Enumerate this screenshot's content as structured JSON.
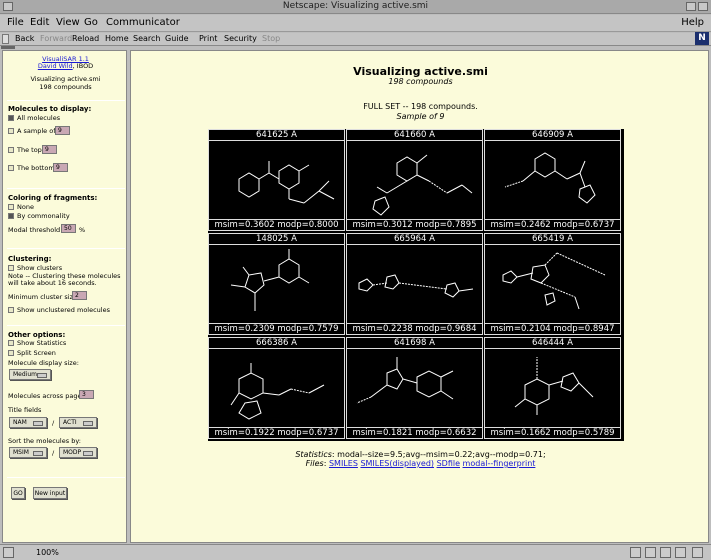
{
  "window": {
    "title": "Netscape: Visualizing active.smi"
  },
  "menu": {
    "file": "File",
    "edit": "Edit",
    "view": "View",
    "go": "Go",
    "communicator": "Communicator",
    "help": "Help"
  },
  "toolbar": {
    "back": "Back",
    "forward": "Forward",
    "reload": "Reload",
    "home": "Home",
    "search": "Search",
    "guide": "Guide",
    "print": "Print",
    "security": "Security",
    "stop": "Stop",
    "logo": "N"
  },
  "sidebar": {
    "app_name": "VisualiSAR 1.1",
    "author": "David Wild",
    "org": ", IBOD",
    "file_title": "Visualizing active.smi",
    "compounds": "198 compounds",
    "display_heading": "Molecules to display:",
    "all_molecules": "All molecules",
    "sample_of": "A sample of",
    "sample_value": "9",
    "the_top": "The top",
    "top_value": "9",
    "the_bottom": "The bottom",
    "bottom_value": "9",
    "coloring_heading": "Coloring of fragments:",
    "none": "None",
    "by_commonality": "By commonality",
    "modal_threshold": "Modal threshold",
    "threshold_value": "50",
    "percent": "%",
    "clustering_heading": "Clustering:",
    "show_clusters": "Show clusters",
    "note1": "Note -- Clustering these molecules",
    "note2": "will take about 16 seconds.",
    "min_cluster_size": "Minimum cluster size",
    "min_cluster_value": "2",
    "show_unclustered": "Show unclustered molecules",
    "other_heading": "Other options:",
    "show_statistics": "Show Statistics",
    "split_screen": "Split Screen",
    "display_size": "Molecule display size:",
    "display_size_value": "Medium",
    "across_page": "Molecules across page",
    "across_value": "3",
    "title_fields": "Title fields",
    "title_field_1": "NAM",
    "slash": "/",
    "title_field_2": "ACTI",
    "sort_by": "Sort the molecules by:",
    "sort_field_1": "MSIM",
    "sort_field_2": "MODP",
    "go": "GO",
    "new_input": "New input"
  },
  "main": {
    "title": "Visualizing active.smi",
    "subtitle": "198 compounds",
    "full_set": "FULL SET -- 198 compounds.",
    "sample": "Sample of 9",
    "stats_label": "Statistics",
    "stats_text": ": modal--size=9.5;avg--msim=0.22;avg--modp=0.71;",
    "files_label": "Files",
    "file_links": [
      "SMILES",
      "SMILES(displayed)",
      "SDfile",
      "modal--fingerprint"
    ]
  },
  "molecules": [
    {
      "id": "641625",
      "activity": "A",
      "stats": "msim=0.3602 modp=0.8000"
    },
    {
      "id": "641660",
      "activity": "A",
      "stats": "msim=0.3012 modp=0.7895"
    },
    {
      "id": "646909",
      "activity": "A",
      "stats": "msim=0.2462 modp=0.6737"
    },
    {
      "id": "148025",
      "activity": "A",
      "stats": "msim=0.2309 modp=0.7579"
    },
    {
      "id": "665964",
      "activity": "A",
      "stats": "msim=0.2238 modp=0.9684"
    },
    {
      "id": "665419",
      "activity": "A",
      "stats": "msim=0.2104 modp=0.8947"
    },
    {
      "id": "666386",
      "activity": "A",
      "stats": "msim=0.1922 modp=0.6737"
    },
    {
      "id": "641698",
      "activity": "A",
      "stats": "msim=0.1821 modp=0.6632"
    },
    {
      "id": "646444",
      "activity": "A",
      "stats": "msim=0.1662 modp=0.5789"
    }
  ],
  "status": {
    "zoom": "100%"
  }
}
